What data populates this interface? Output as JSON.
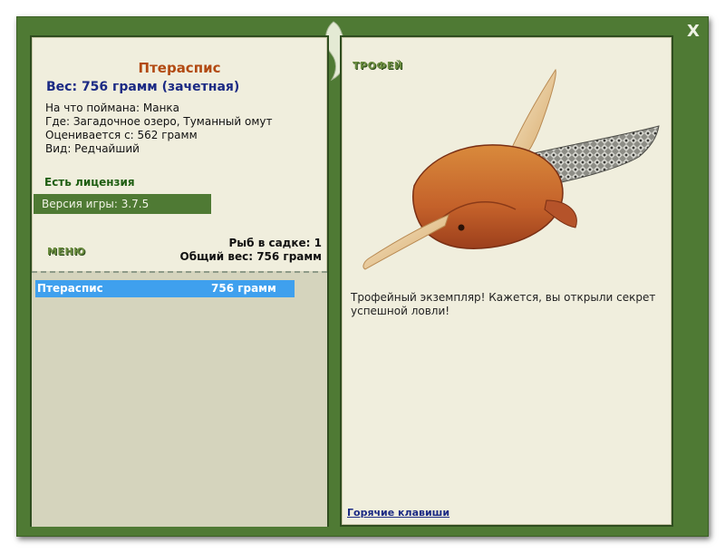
{
  "close_label": "X",
  "fish": {
    "name": "Птераспис",
    "weight": "Вес: 756 грамм (зачетная)",
    "bait": "На что поймана: Манка",
    "where": "Где: Загадочное озеро, Туманный омут",
    "rated": "Оценивается с: 562 грамм",
    "kind": "Вид: Редчайший"
  },
  "license": "Есть лицензия",
  "version": "Версия игры: 3.7.5",
  "menu_label": "МЕНЮ",
  "stats": {
    "fish_count": "Рыб в садке: 1",
    "total_weight": "Общий вес: 756 грамм"
  },
  "catch_list": [
    {
      "name": "Птераспис",
      "weight": "756 грамм"
    }
  ],
  "trophy": {
    "title": "ТРОФЕЙ",
    "description": "Трофейный экземпляр! Кажется, вы открыли секрет успешной ловли!"
  },
  "hotkeys_label": "Горячие клавиши",
  "colors": {
    "frame": "#4f7a34",
    "panel": "#f0eedd",
    "list_bg": "#d5d4bd",
    "selection": "#3fa0ee",
    "fish_name": "#b24a12",
    "weight": "#1b2a84",
    "license": "#1f5e12"
  },
  "icons": {
    "mascot": "chameleon-logo-icon",
    "close": "close-icon",
    "trophy_image": "pteraspis-fish-image"
  }
}
